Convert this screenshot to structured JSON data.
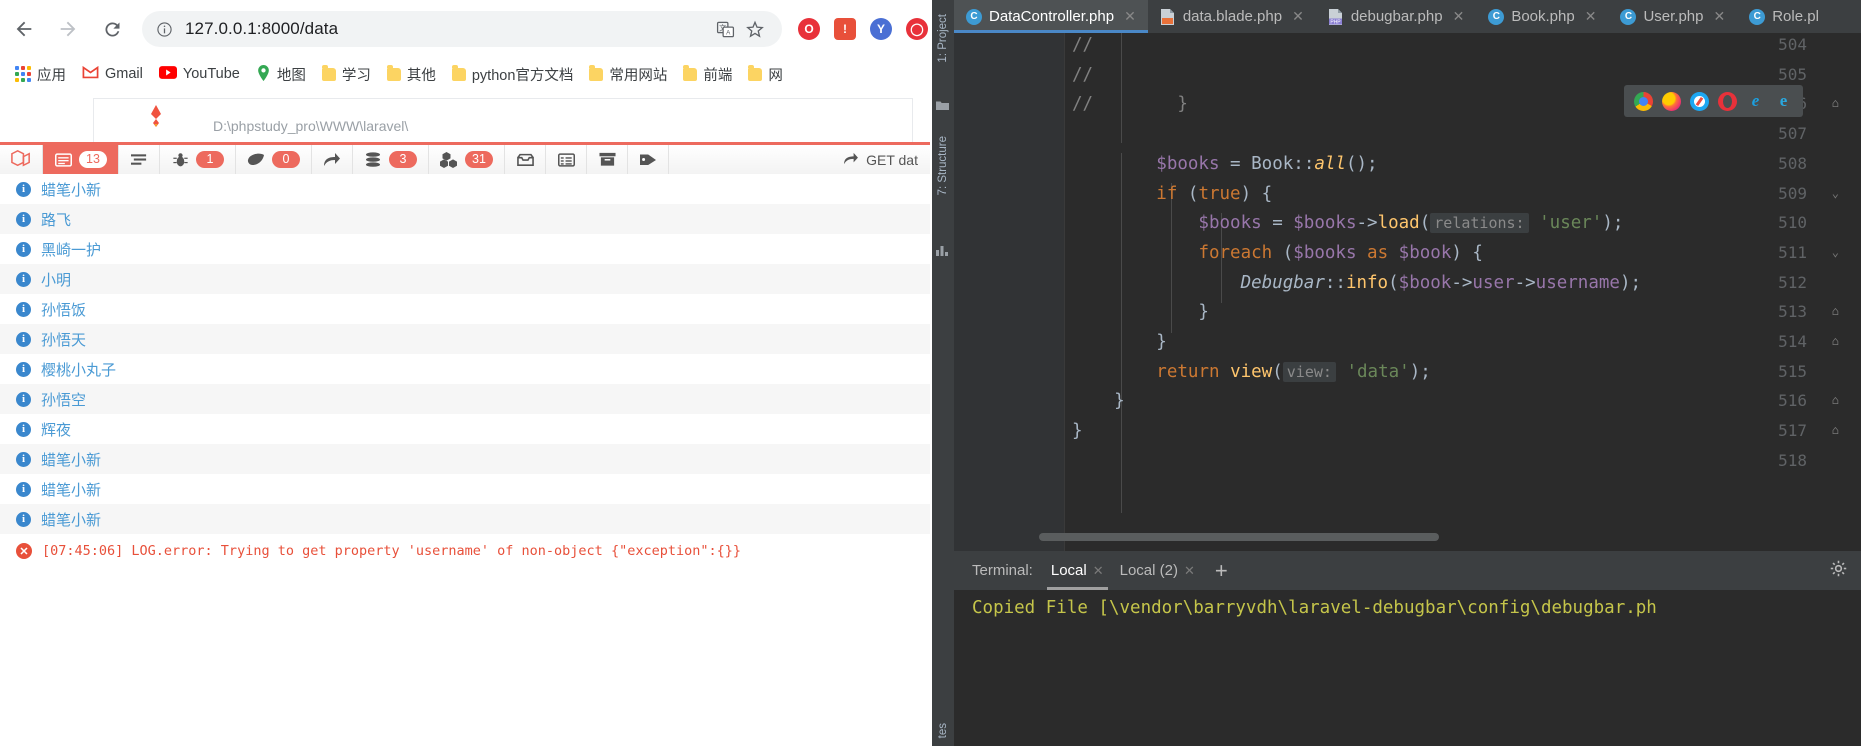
{
  "browser": {
    "nav": {
      "back": "←",
      "forward": "→",
      "reload": "⟳"
    },
    "omnibox": {
      "url": "127.0.0.1:8000/data",
      "info_icon": "info-circle-icon",
      "translate_icon": "translate-icon",
      "star_icon": "bookmark-star-icon"
    },
    "bookmarks": [
      {
        "label": "应用",
        "icon": "apps-grid-icon"
      },
      {
        "label": "Gmail",
        "icon": "gmail-icon"
      },
      {
        "label": "YouTube",
        "icon": "youtube-icon"
      },
      {
        "label": "地图",
        "icon": "maps-icon"
      },
      {
        "label": "学习",
        "icon": "folder-icon"
      },
      {
        "label": "其他",
        "icon": "folder-icon"
      },
      {
        "label": "python官方文档",
        "icon": "folder-icon"
      },
      {
        "label": "常用网站",
        "icon": "folder-icon"
      },
      {
        "label": "前端",
        "icon": "folder-icon"
      },
      {
        "label": "网",
        "icon": "folder-icon"
      }
    ],
    "page": {
      "phpstudy_path": "D:\\phpstudy_pro\\WWW\\laravel\\"
    }
  },
  "debugbar": {
    "brand": "laravel-logo",
    "items": [
      {
        "name": "messages",
        "icon": "message-icon",
        "badge": "13",
        "active": true
      },
      {
        "name": "timeline",
        "icon": "timeline-icon",
        "badge": "",
        "active": false
      },
      {
        "name": "exceptions",
        "icon": "bug-icon",
        "badge": "1",
        "active": false
      },
      {
        "name": "views",
        "icon": "leaf-icon",
        "badge": "0",
        "active": false
      },
      {
        "name": "route",
        "icon": "arrow-share-icon",
        "badge": "",
        "active": false
      },
      {
        "name": "queries",
        "icon": "database-icon",
        "badge": "3",
        "active": false
      },
      {
        "name": "models",
        "icon": "cubes-icon",
        "badge": "31",
        "active": false
      },
      {
        "name": "mails",
        "icon": "inbox-icon",
        "badge": "",
        "active": false
      },
      {
        "name": "request",
        "icon": "table-icon",
        "badge": "",
        "active": false
      },
      {
        "name": "session",
        "icon": "archive-icon",
        "badge": "",
        "active": false
      },
      {
        "name": "tags",
        "icon": "tag-icon",
        "badge": "",
        "active": false
      }
    ],
    "request_label": "GET dat"
  },
  "messages": [
    {
      "level": "info",
      "text": "蜡笔小新"
    },
    {
      "level": "info",
      "text": "路飞"
    },
    {
      "level": "info",
      "text": "黑崎一护"
    },
    {
      "level": "info",
      "text": "小明"
    },
    {
      "level": "info",
      "text": "孙悟饭"
    },
    {
      "level": "info",
      "text": "孙悟天"
    },
    {
      "level": "info",
      "text": "樱桃小丸子"
    },
    {
      "level": "info",
      "text": "孙悟空"
    },
    {
      "level": "info",
      "text": "辉夜"
    },
    {
      "level": "info",
      "text": "蜡笔小新"
    },
    {
      "level": "info",
      "text": "蜡笔小新"
    },
    {
      "level": "info",
      "text": "蜡笔小新"
    },
    {
      "level": "error",
      "text": "[07:45:06] LOG.error: Trying to get property 'username' of non-object {\"exception\":{}}"
    }
  ],
  "ide": {
    "tabs": [
      {
        "label": "DataController.php",
        "icon": "php-class-icon",
        "active": true,
        "close": "✕"
      },
      {
        "label": "data.blade.php",
        "icon": "blade-file-icon",
        "active": false,
        "close": "✕"
      },
      {
        "label": "debugbar.php",
        "icon": "php-file-icon",
        "active": false,
        "close": "✕"
      },
      {
        "label": "Book.php",
        "icon": "php-class-icon",
        "active": false,
        "close": "✕"
      },
      {
        "label": "User.php",
        "icon": "php-class-icon",
        "active": false,
        "close": "✕"
      },
      {
        "label": "Role.pl",
        "icon": "php-class-icon",
        "active": false,
        "close": ""
      }
    ],
    "left_tool_windows": [
      {
        "label": "1: Project"
      },
      {
        "label": "7: Structure"
      }
    ],
    "code": {
      "lines": [
        {
          "no": "504",
          "indent": 0,
          "segments": [
            {
              "t": "//",
              "c": "cmt"
            }
          ],
          "fold": ""
        },
        {
          "no": "505",
          "indent": 0,
          "segments": [
            {
              "t": "//",
              "c": "cmt"
            }
          ],
          "fold": ""
        },
        {
          "no": "506",
          "indent": 0,
          "segments": [
            {
              "t": "//        }",
              "c": "cmt"
            }
          ],
          "fold": "⌂"
        },
        {
          "no": "507",
          "indent": 0,
          "segments": [],
          "fold": ""
        },
        {
          "no": "508",
          "indent": 0,
          "segments": [
            {
              "t": "        $books",
              "c": "var"
            },
            {
              "t": " = ",
              "c": ""
            },
            {
              "t": "Book",
              "c": ""
            },
            {
              "t": "::",
              "c": ""
            },
            {
              "t": "all",
              "c": "fn italic"
            },
            {
              "t": "();",
              "c": ""
            }
          ],
          "fold": ""
        },
        {
          "no": "509",
          "indent": 0,
          "segments": [
            {
              "t": "        ",
              "c": ""
            },
            {
              "t": "if",
              "c": "kw"
            },
            {
              "t": " (",
              "c": ""
            },
            {
              "t": "true",
              "c": "kw"
            },
            {
              "t": ") {",
              "c": ""
            }
          ],
          "fold": "⌄"
        },
        {
          "no": "510",
          "indent": 1,
          "segments": [
            {
              "t": "            $books",
              "c": "var"
            },
            {
              "t": " = ",
              "c": ""
            },
            {
              "t": "$books",
              "c": "var"
            },
            {
              "t": "->",
              "c": ""
            },
            {
              "t": "load",
              "c": "fn"
            },
            {
              "t": "(",
              "c": ""
            },
            {
              "t": "relations:",
              "c": "hint"
            },
            {
              "t": " ",
              "c": ""
            },
            {
              "t": "'user'",
              "c": "str"
            },
            {
              "t": ");",
              "c": ""
            }
          ],
          "fold": ""
        },
        {
          "no": "511",
          "indent": 1,
          "segments": [
            {
              "t": "            ",
              "c": ""
            },
            {
              "t": "foreach",
              "c": "kw"
            },
            {
              "t": " (",
              "c": ""
            },
            {
              "t": "$books",
              "c": "var"
            },
            {
              "t": " ",
              "c": ""
            },
            {
              "t": "as",
              "c": "kw"
            },
            {
              "t": " ",
              "c": ""
            },
            {
              "t": "$book",
              "c": "var"
            },
            {
              "t": ") {",
              "c": ""
            }
          ],
          "fold": "⌄"
        },
        {
          "no": "512",
          "indent": 2,
          "segments": [
            {
              "t": "                ",
              "c": ""
            },
            {
              "t": "Debugbar",
              "c": "italic"
            },
            {
              "t": "::",
              "c": ""
            },
            {
              "t": "info",
              "c": "fn"
            },
            {
              "t": "(",
              "c": ""
            },
            {
              "t": "$book",
              "c": "var"
            },
            {
              "t": "->",
              "c": ""
            },
            {
              "t": "user",
              "c": "var"
            },
            {
              "t": "->",
              "c": ""
            },
            {
              "t": "username",
              "c": "var"
            },
            {
              "t": ");",
              "c": ""
            }
          ],
          "fold": ""
        },
        {
          "no": "513",
          "indent": 2,
          "segments": [
            {
              "t": "            }",
              "c": ""
            }
          ],
          "fold": "⌂"
        },
        {
          "no": "514",
          "indent": 1,
          "segments": [
            {
              "t": "        }",
              "c": ""
            }
          ],
          "fold": "⌂"
        },
        {
          "no": "515",
          "indent": 0,
          "segments": [
            {
              "t": "        ",
              "c": ""
            },
            {
              "t": "return",
              "c": "kw"
            },
            {
              "t": " ",
              "c": ""
            },
            {
              "t": "view",
              "c": "fn"
            },
            {
              "t": "(",
              "c": ""
            },
            {
              "t": "view:",
              "c": "hint"
            },
            {
              "t": " ",
              "c": ""
            },
            {
              "t": "'data'",
              "c": "str"
            },
            {
              "t": ");",
              "c": ""
            }
          ],
          "fold": ""
        },
        {
          "no": "516",
          "indent": 0,
          "segments": [
            {
              "t": "    }",
              "c": ""
            }
          ],
          "fold": "⌂"
        },
        {
          "no": "517",
          "indent": 0,
          "segments": [
            {
              "t": "}",
              "c": ""
            }
          ],
          "fold": "⌂"
        },
        {
          "no": "518",
          "indent": 0,
          "segments": [],
          "fold": ""
        }
      ]
    },
    "browser_popup": {
      "icons": [
        "chrome-icon",
        "firefox-icon",
        "safari-icon",
        "opera-icon",
        "edge-legacy-icon",
        "ie-icon"
      ]
    },
    "terminal": {
      "label": "Terminal:",
      "tabs": [
        {
          "label": "Local",
          "active": true,
          "close": "✕"
        },
        {
          "label": "Local (2)",
          "active": false,
          "close": "✕"
        }
      ],
      "add": "+",
      "settings_icon": "gear-icon",
      "output": "Copied File [\\vendor\\barryvdh\\laravel-debugbar\\config\\debugbar.ph"
    }
  },
  "colors": {
    "accent_red": "#ed6a5e",
    "info_blue": "#4a9ad4",
    "error_red": "#e8503a",
    "ide_bg": "#2b2b2b",
    "ide_chrome": "#3c3f41"
  }
}
